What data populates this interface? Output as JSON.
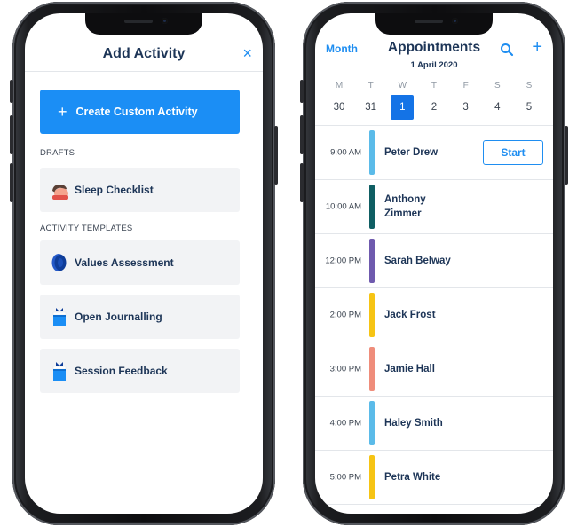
{
  "add_activity": {
    "title": "Add Activity",
    "close_icon": "×",
    "create_button": {
      "icon": "+",
      "label": "Create Custom Activity"
    },
    "drafts_heading": "DRAFTS",
    "drafts": [
      {
        "label": "Sleep Checklist",
        "icon": "sleep-icon"
      }
    ],
    "templates_heading": "ACTIVITY TEMPLATES",
    "templates": [
      {
        "label": "Values Assessment",
        "icon": "values-icon"
      },
      {
        "label": "Open Journalling",
        "icon": "gift-icon"
      },
      {
        "label": "Session Feedback",
        "icon": "gift-icon"
      }
    ]
  },
  "appointments": {
    "month_link": "Month",
    "title": "Appointments",
    "date": "1 April 2020",
    "add_icon": "+",
    "weekdays": [
      "M",
      "T",
      "W",
      "T",
      "F",
      "S",
      "S"
    ],
    "days": [
      "30",
      "31",
      "1",
      "2",
      "3",
      "4",
      "5"
    ],
    "selected_day": "1",
    "start_label": "Start",
    "items": [
      {
        "time": "9:00 AM",
        "name": "Peter Drew",
        "color": "#5bbbe9",
        "has_start": true
      },
      {
        "time": "10:00 AM",
        "name": "Anthony Zimmer",
        "color": "#0f5e63",
        "has_start": false
      },
      {
        "time": "12:00 PM",
        "name": "Sarah Belway",
        "color": "#6f5aae",
        "has_start": false
      },
      {
        "time": "2:00 PM",
        "name": "Jack Frost",
        "color": "#f6c414",
        "has_start": false
      },
      {
        "time": "3:00 PM",
        "name": "Jamie Hall",
        "color": "#ef8d7b",
        "has_start": false
      },
      {
        "time": "4:00 PM",
        "name": "Haley Smith",
        "color": "#5bbbe9",
        "has_start": false
      },
      {
        "time": "5:00 PM",
        "name": "Petra White",
        "color": "#f6c414",
        "has_start": false
      }
    ]
  },
  "colors": {
    "accent": "#1b8ef5",
    "selected_day": "#1473e6",
    "heading_text": "#1d3557",
    "card_bg": "#f2f3f5"
  }
}
